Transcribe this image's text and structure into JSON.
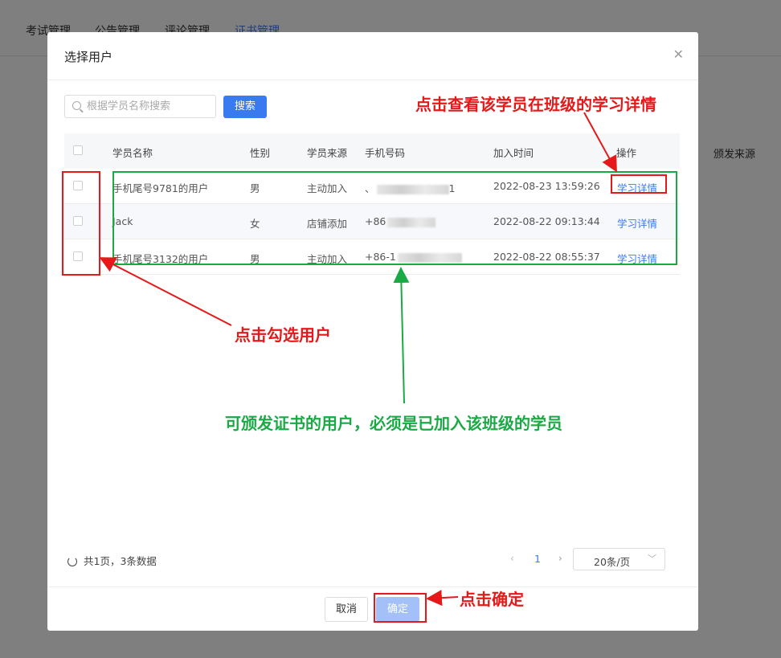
{
  "background": {
    "tabs": [
      "考试管理",
      "公告管理",
      "评论管理",
      "证书管理"
    ],
    "active_tab": 3,
    "extra_column": "颁发来源"
  },
  "modal": {
    "title": "选择用户",
    "close_icon": "close-icon",
    "search": {
      "placeholder": "根据学员名称搜索",
      "value": "",
      "button": "搜索"
    },
    "table": {
      "columns": [
        "学员名称",
        "性别",
        "学员来源",
        "手机号码",
        "加入时间",
        "操作"
      ],
      "rows": [
        {
          "name": "手机尾号9781的用户",
          "gender": "男",
          "source": "主动加入",
          "phone": "、",
          "phone_tail": "1",
          "joined": "2022-08-23 13:59:26",
          "action": "学习详情"
        },
        {
          "name": "Jack",
          "gender": "女",
          "source": "店铺添加",
          "phone": "+86",
          "phone_tail": "",
          "joined": "2022-08-22 09:13:44",
          "action": "学习详情"
        },
        {
          "name": "手机尾号3132的用户",
          "gender": "男",
          "source": "主动加入",
          "phone": "+86-1",
          "phone_tail": "",
          "joined": "2022-08-22 08:55:37",
          "action": "学习详情"
        }
      ]
    },
    "footer_info": "共1页，3条数据",
    "pagination": {
      "prev": "‹",
      "current": "1",
      "next": "›",
      "page_size": "20条/页"
    },
    "buttons": {
      "cancel": "取消",
      "confirm": "确定"
    }
  },
  "annotations": {
    "detail_hint": "点击查看该学员在班级的学习详情",
    "select_hint": "点击勾选用户",
    "eligibility_hint": "可颁发证书的用户，必须是已加入该班级的学员",
    "confirm_hint": "点击确定"
  },
  "colors": {
    "accent": "#3a7af0",
    "annotation_red": "#e5191a",
    "annotation_green": "#1aaa45"
  }
}
